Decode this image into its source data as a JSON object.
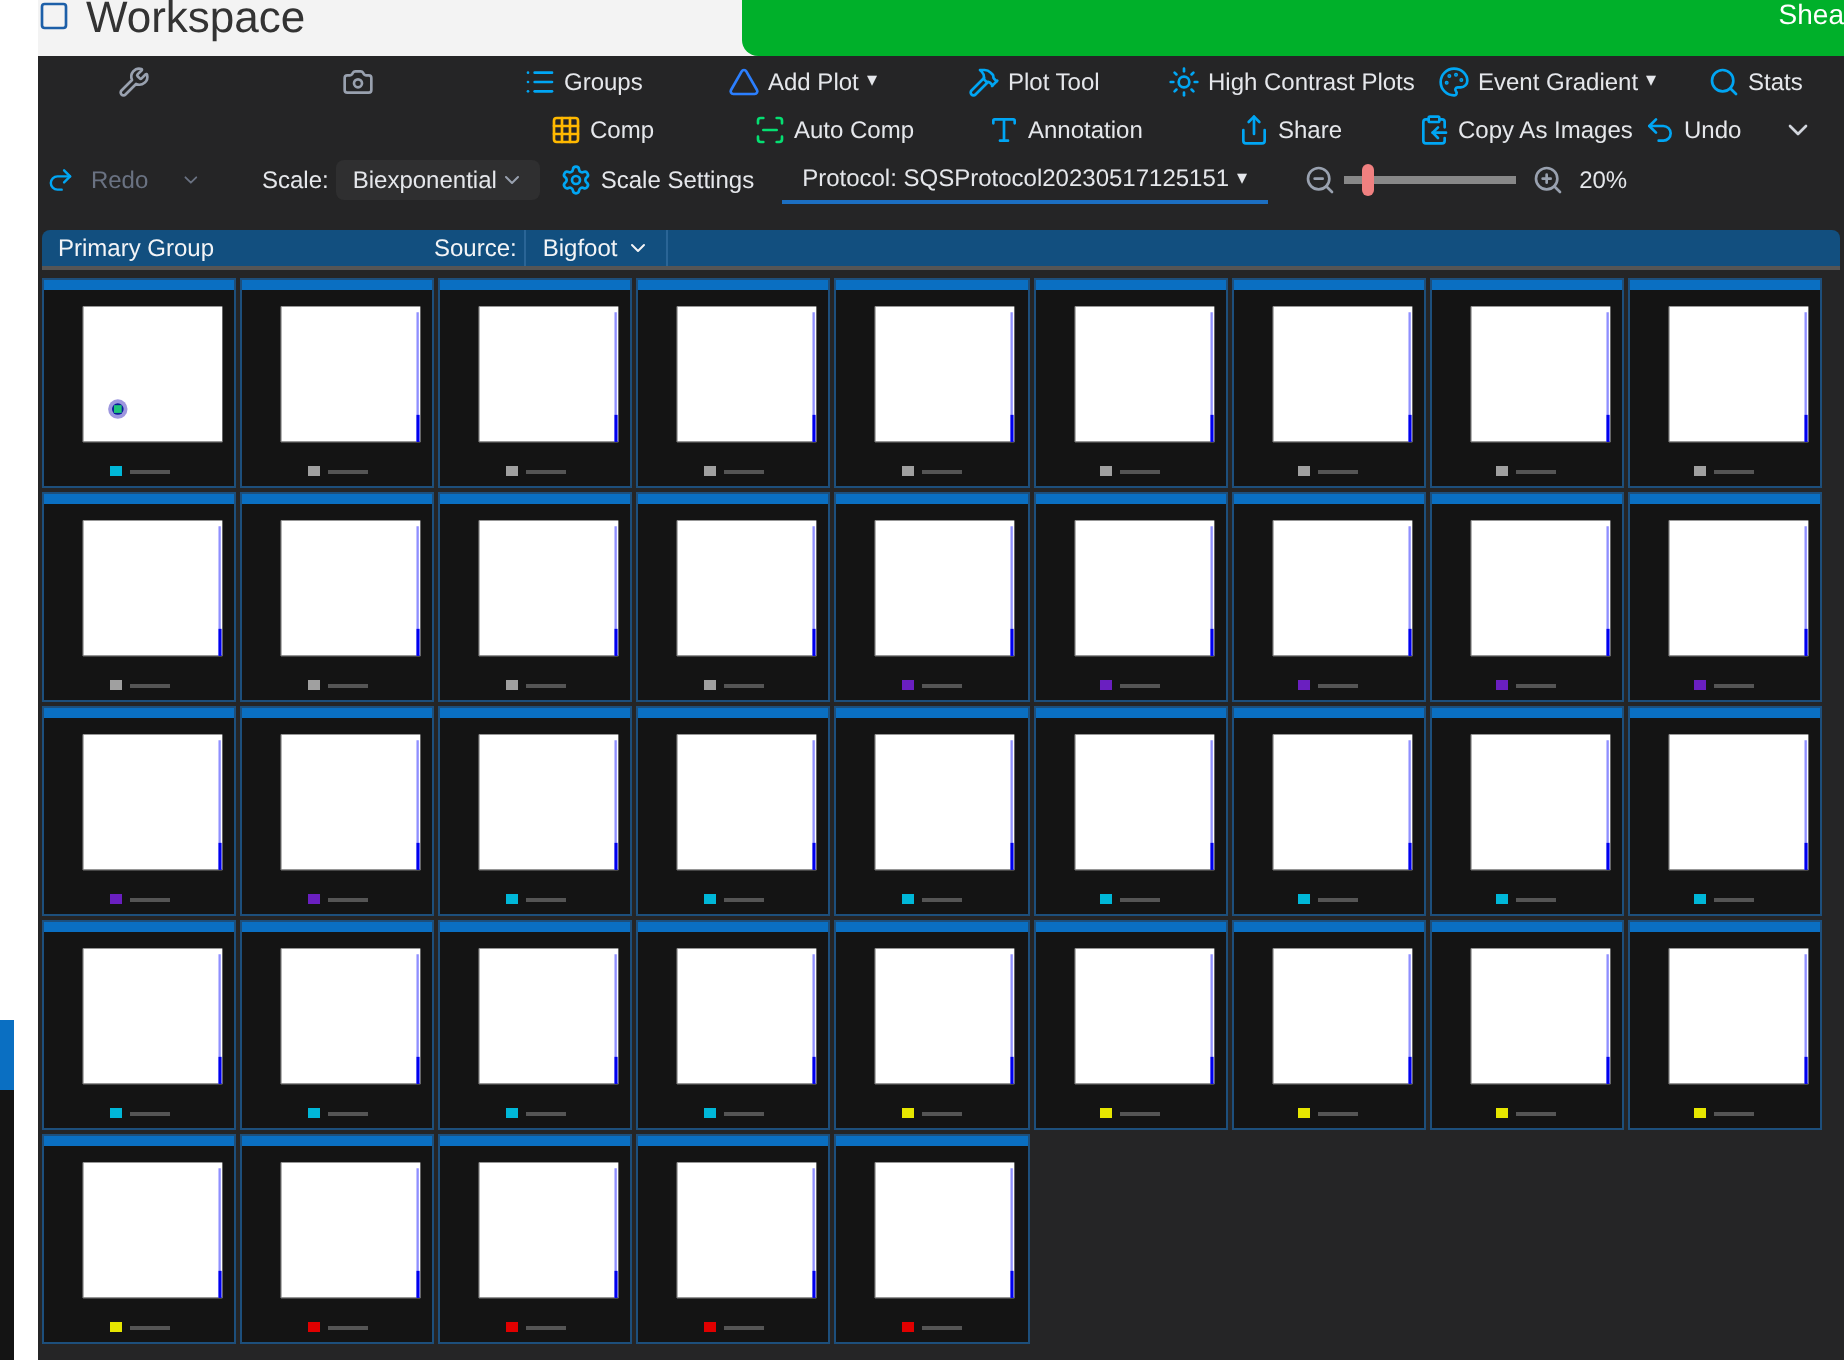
{
  "window": {
    "title": "Workspace"
  },
  "banner": {
    "text": "Shea"
  },
  "toolbar": {
    "row_1": [
      {
        "kind": "tools"
      },
      {
        "kind": "camera"
      },
      {
        "kind": "groups",
        "label": "Groups"
      },
      {
        "kind": "addplot",
        "label": "Add Plot",
        "caret": "▾"
      },
      {
        "kind": "plottool",
        "label": "Plot Tool"
      },
      {
        "kind": "contrast",
        "label": "High Contrast Plots"
      },
      {
        "kind": "gradient",
        "label": "Event Gradient",
        "caret": "▾"
      },
      {
        "kind": "stats",
        "label": "Stats"
      }
    ],
    "row_2": [
      {
        "kind": "comp",
        "label": "Comp"
      },
      {
        "kind": "autocomp",
        "label": "Auto Comp"
      },
      {
        "kind": "annotation",
        "label": "Annotation"
      },
      {
        "kind": "share",
        "label": "Share"
      },
      {
        "kind": "copy",
        "label": "Copy As Images"
      },
      {
        "kind": "undo",
        "label": "Undo",
        "disabled": false
      }
    ],
    "redo": {
      "label": "Redo",
      "disabled": true
    },
    "scale": {
      "label": "Scale:",
      "value": "Biexponential"
    },
    "scale_settings": {
      "label": "Scale Settings"
    },
    "protocol": {
      "label": "Protocol: SQSProtocol20230517125151",
      "caret": "▾"
    },
    "zoom": {
      "level": 0.12,
      "reading": "20%"
    }
  },
  "group_bar": {
    "title": "Primary Group",
    "source_label": "Source:",
    "source_value": "Bigfoot"
  },
  "plots": [
    {
      "kind": "dot",
      "color": "#00b7d8"
    },
    {
      "kind": "histogram",
      "color": "#a0a0a0"
    },
    {
      "kind": "histogram",
      "color": "#a0a0a0"
    },
    {
      "kind": "histogram",
      "color": "#a0a0a0"
    },
    {
      "kind": "histogram",
      "color": "#a0a0a0"
    },
    {
      "kind": "histogram",
      "color": "#a0a0a0"
    },
    {
      "kind": "histogram",
      "color": "#a0a0a0"
    },
    {
      "kind": "histogram",
      "color": "#a0a0a0"
    },
    {
      "kind": "histogram",
      "color": "#a0a0a0"
    },
    {
      "kind": "histogram",
      "color": "#a0a0a0"
    },
    {
      "kind": "histogram",
      "color": "#a0a0a0"
    },
    {
      "kind": "histogram",
      "color": "#a0a0a0"
    },
    {
      "kind": "histogram",
      "color": "#a0a0a0"
    },
    {
      "kind": "histogram",
      "color": "#6a1fc0"
    },
    {
      "kind": "histogram",
      "color": "#6a1fc0"
    },
    {
      "kind": "histogram",
      "color": "#6a1fc0"
    },
    {
      "kind": "histogram",
      "color": "#6a1fc0"
    },
    {
      "kind": "histogram",
      "color": "#6a1fc0"
    },
    {
      "kind": "histogram",
      "color": "#6a1fc0"
    },
    {
      "kind": "histogram",
      "color": "#6a1fc0"
    },
    {
      "kind": "histogram",
      "color": "#00b7d8"
    },
    {
      "kind": "histogram",
      "color": "#00b7d8"
    },
    {
      "kind": "histogram",
      "color": "#00b7d8"
    },
    {
      "kind": "histogram",
      "color": "#00b7d8"
    },
    {
      "kind": "histogram",
      "color": "#00b7d8"
    },
    {
      "kind": "histogram",
      "color": "#00b7d8"
    },
    {
      "kind": "histogram",
      "color": "#00b7d8"
    },
    {
      "kind": "histogram",
      "color": "#00b7d8"
    },
    {
      "kind": "histogram",
      "color": "#00b7d8"
    },
    {
      "kind": "histogram",
      "color": "#00b7d8"
    },
    {
      "kind": "histogram",
      "color": "#00b7d8"
    },
    {
      "kind": "histogram",
      "color": "#e6e600"
    },
    {
      "kind": "histogram",
      "color": "#e6e600"
    },
    {
      "kind": "histogram",
      "color": "#e6e600"
    },
    {
      "kind": "histogram",
      "color": "#e6e600"
    },
    {
      "kind": "histogram",
      "color": "#e6e600"
    },
    {
      "kind": "histogram",
      "color": "#e6e600"
    },
    {
      "kind": "histogram",
      "color": "#e00000"
    },
    {
      "kind": "histogram",
      "color": "#e00000"
    },
    {
      "kind": "histogram",
      "color": "#e00000"
    },
    {
      "kind": "histogram",
      "color": "#e00000"
    }
  ]
}
